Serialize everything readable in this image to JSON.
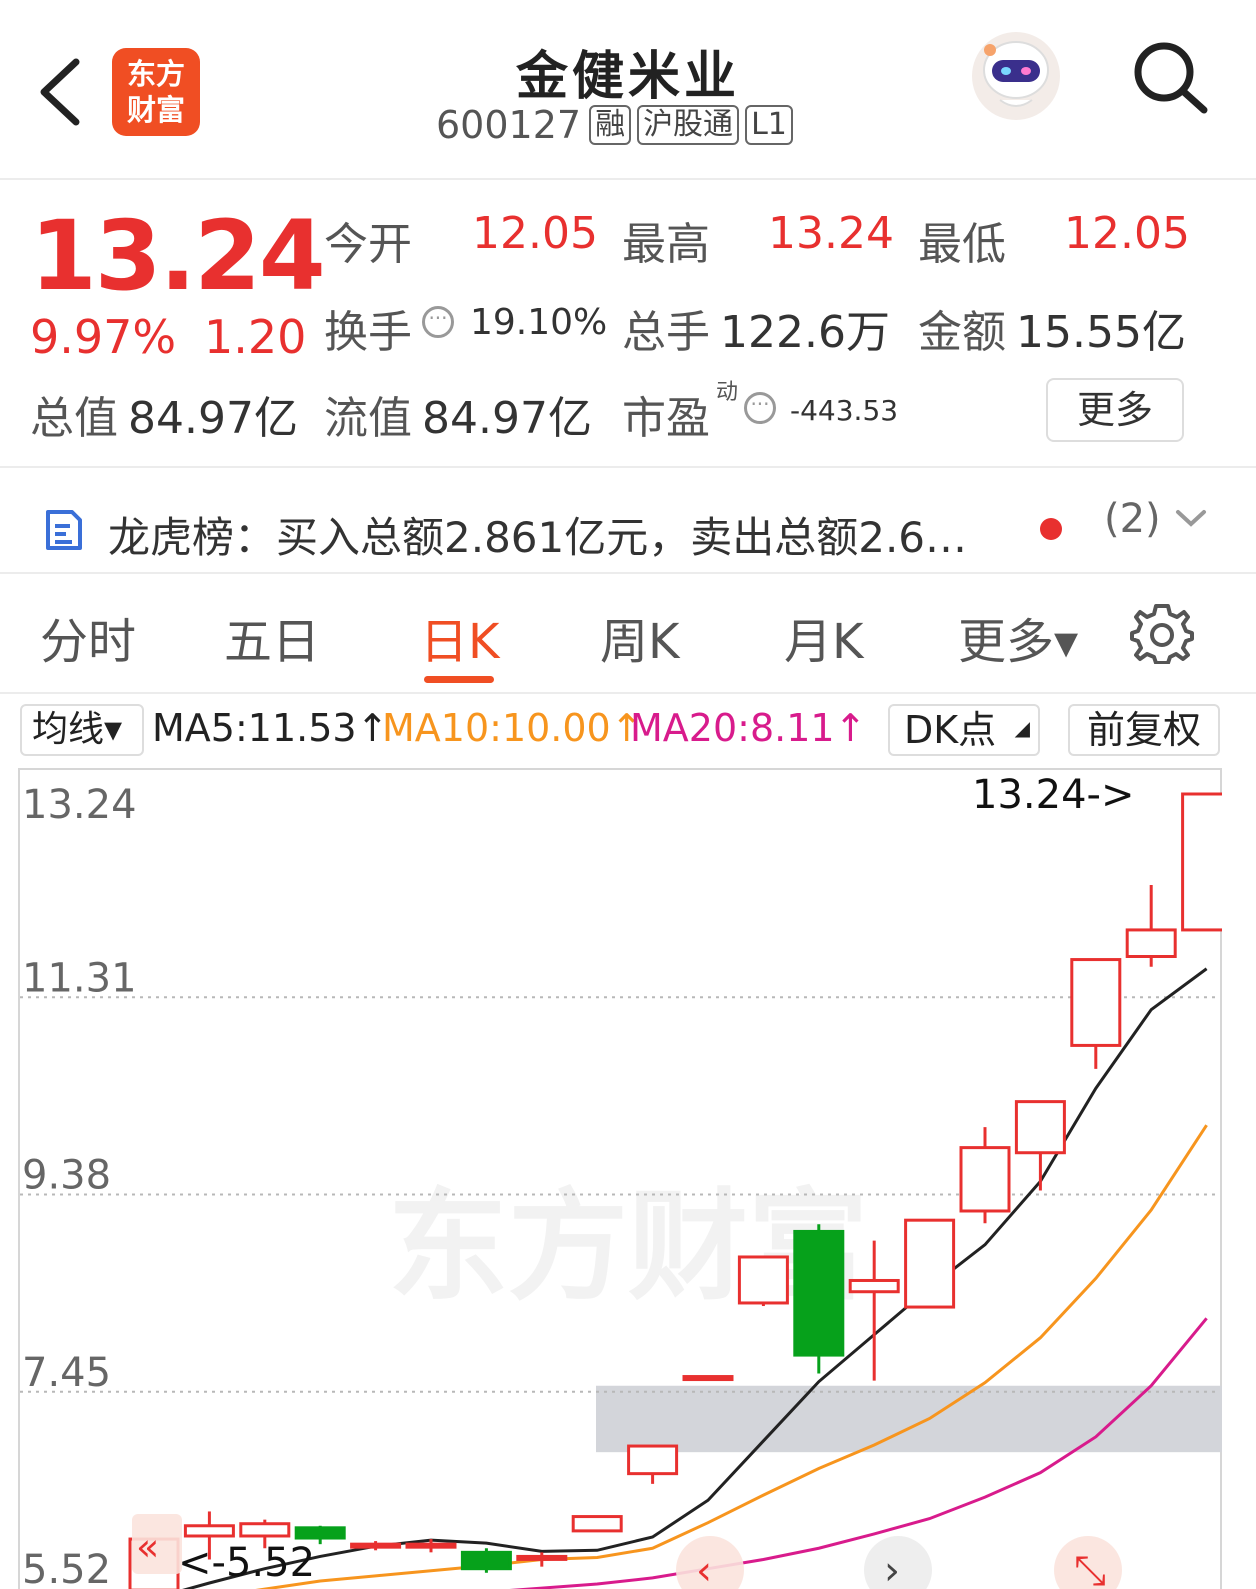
{
  "header": {
    "back_label": "返回",
    "logo_line1": "东方",
    "logo_line2": "财富",
    "title": "金健米业",
    "code": "600127",
    "tags": [
      "融",
      "沪股通",
      "L1"
    ]
  },
  "quote": {
    "price": "13.24",
    "change_pct": "9.97%",
    "change": "1.20",
    "open_label": "今开",
    "open": "12.05",
    "high_label": "最高",
    "high": "13.24",
    "low_label": "最低",
    "low": "12.05",
    "turnover_label": "换手",
    "turnover": "19.10%",
    "volume_label": "总手",
    "volume": "122.6万",
    "amount_label": "金额",
    "amount": "15.55亿",
    "total_mv_label": "总值",
    "total_mv": "84.97亿",
    "float_mv_label": "流值",
    "float_mv": "84.97亿",
    "pe_label": "市盈",
    "pe_sup": "动",
    "pe": "-443.53",
    "more_label": "更多"
  },
  "notice": {
    "text": "龙虎榜：买入总额2.861亿元，卖出总额2.6…",
    "count": "(2)"
  },
  "tabs": [
    "分时",
    "五日",
    "日K",
    "周K",
    "月K",
    "更多▾"
  ],
  "active_tab": "日K",
  "ma_row": {
    "select_label": "均线▾",
    "ma5": "MA5:11.53↑",
    "ma10": "MA10:10.00↑",
    "ma20": "MA20:8.11↑",
    "dk_label": "DK点",
    "fq_label": "前复权"
  },
  "colors": {
    "up": "#e8302f",
    "down": "#06a11b",
    "ma5": "#222222",
    "ma10": "#f7951e",
    "ma20": "#d81b8c",
    "accent": "#f04e23"
  },
  "chart_data": {
    "type": "candlestick",
    "ylim": [
      5.52,
      13.24
    ],
    "y_ticks": [
      "13.24",
      "11.31",
      "9.38",
      "7.45",
      "5.52"
    ],
    "max_label": "13.24->",
    "min_label": "<-5.52",
    "candles": [
      {
        "o": 5.45,
        "c": 5.95,
        "h": 5.95,
        "l": 5.4
      },
      {
        "o": 5.98,
        "c": 6.08,
        "h": 6.22,
        "l": 5.75
      },
      {
        "o": 5.98,
        "c": 6.1,
        "h": 6.14,
        "l": 5.86
      },
      {
        "o": 6.06,
        "c": 5.96,
        "h": 6.08,
        "l": 5.9
      },
      {
        "o": 5.9,
        "c": 5.9,
        "h": 5.93,
        "l": 5.84
      },
      {
        "o": 5.9,
        "c": 5.9,
        "h": 5.95,
        "l": 5.82
      },
      {
        "o": 5.82,
        "c": 5.66,
        "h": 5.86,
        "l": 5.62
      },
      {
        "o": 5.78,
        "c": 5.78,
        "h": 5.82,
        "l": 5.68
      },
      {
        "o": 6.03,
        "c": 6.17,
        "h": 6.18,
        "l": 6.02
      },
      {
        "o": 6.59,
        "c": 6.86,
        "h": 6.86,
        "l": 6.49
      },
      {
        "o": 7.54,
        "c": 7.54,
        "h": 7.54,
        "l": 7.54
      },
      {
        "o": 8.26,
        "c": 8.71,
        "h": 8.71,
        "l": 8.23
      },
      {
        "o": 8.96,
        "c": 7.75,
        "h": 9.03,
        "l": 7.57
      },
      {
        "o": 8.37,
        "c": 8.48,
        "h": 8.87,
        "l": 7.5
      },
      {
        "o": 8.22,
        "c": 9.07,
        "h": 9.07,
        "l": 8.22
      },
      {
        "o": 9.16,
        "c": 9.78,
        "h": 9.98,
        "l": 9.04
      },
      {
        "o": 9.73,
        "c": 10.23,
        "h": 10.23,
        "l": 9.36
      },
      {
        "o": 10.78,
        "c": 11.62,
        "h": 11.62,
        "l": 10.55
      },
      {
        "o": 11.65,
        "c": 11.91,
        "h": 12.35,
        "l": 11.55
      },
      {
        "o": 11.91,
        "c": 13.24,
        "h": 13.24,
        "l": 11.91
      }
    ],
    "ma5": [
      5.37,
      5.52,
      5.66,
      5.78,
      5.88,
      5.94,
      5.91,
      5.83,
      5.84,
      5.97,
      6.33,
      6.91,
      7.49,
      7.95,
      8.41,
      8.83,
      9.45,
      10.36,
      11.13,
      11.53
    ],
    "ma10": [
      5.3,
      5.38,
      5.46,
      5.54,
      5.59,
      5.64,
      5.69,
      5.75,
      5.77,
      5.86,
      6.11,
      6.38,
      6.64,
      6.87,
      7.13,
      7.48,
      7.92,
      8.5,
      9.17,
      10.0
    ],
    "ma20": [
      5.05,
      5.14,
      5.21,
      5.29,
      5.34,
      5.38,
      5.43,
      5.47,
      5.51,
      5.57,
      5.66,
      5.75,
      5.86,
      6.0,
      6.15,
      6.36,
      6.6,
      6.95,
      7.45,
      8.11
    ],
    "dk_zone": [
      6.8,
      7.45
    ]
  },
  "watermark": "东方财富"
}
